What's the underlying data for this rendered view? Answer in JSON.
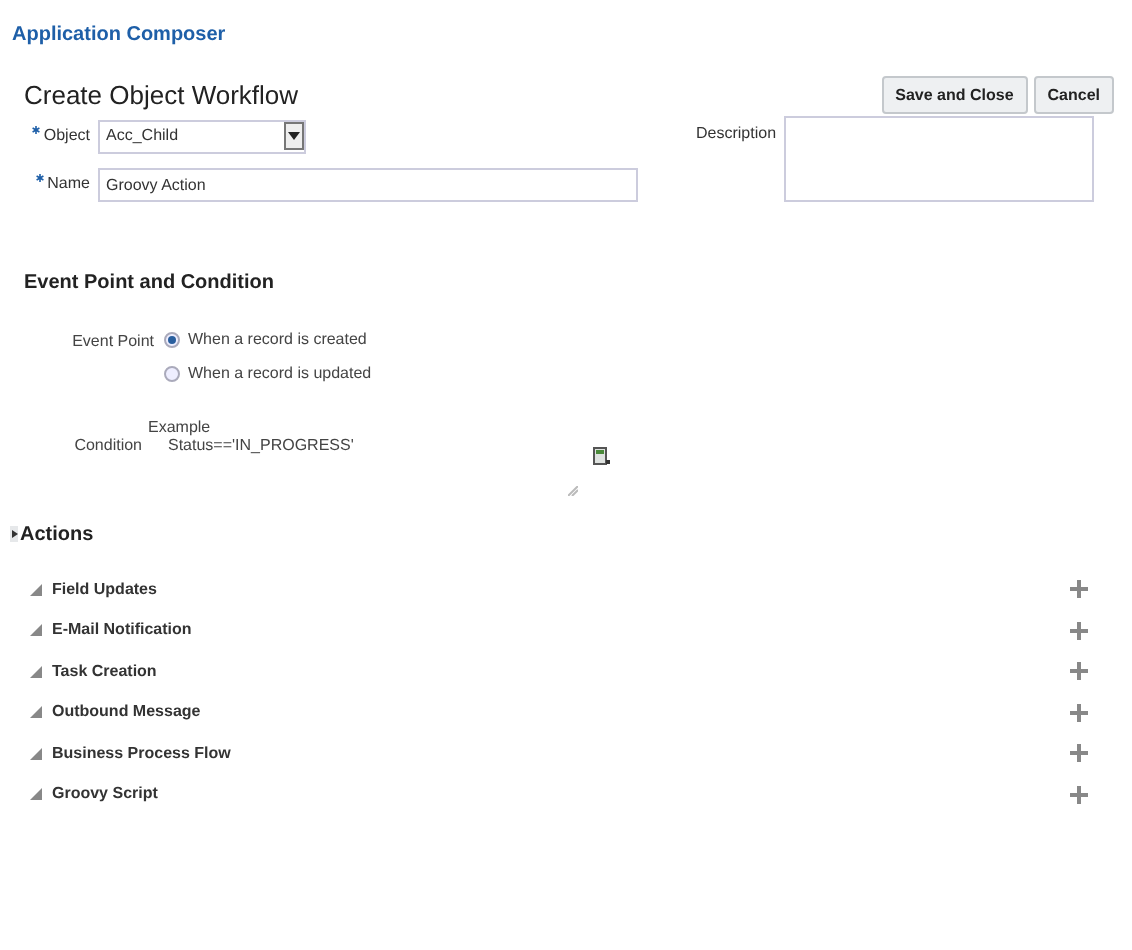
{
  "app_title": "Application Composer",
  "page_title": "Create Object Workflow",
  "buttons": [
    "Save and Close",
    "Cancel"
  ],
  "fields": {
    "object": {
      "label": "Object",
      "required": true,
      "value": "Acc_Child"
    },
    "name": {
      "label": "Name",
      "required": true,
      "value": "Groovy Action"
    },
    "description": {
      "label": "Description"
    }
  },
  "event_section": {
    "title": "Event Point and Condition",
    "event_label": "Event Point",
    "options": [
      {
        "label": "When a record is created",
        "selected": true
      },
      {
        "label": "When a record is updated",
        "selected": false
      }
    ],
    "condition_label": "Condition",
    "condition_lines": [
      "Example",
      "Status=='IN_PROGRESS'"
    ]
  },
  "actions": {
    "title": "Actions",
    "items": [
      {
        "label": "Field Updates",
        "expanded": true
      },
      {
        "label": "E-Mail Notification",
        "expanded": true
      },
      {
        "label": "Task Creation",
        "expanded": true
      },
      {
        "label": "Outbound Message",
        "expanded": true
      },
      {
        "label": "Business Process Flow",
        "expanded": true
      },
      {
        "label": "Groovy Script",
        "expanded": true
      }
    ]
  }
}
